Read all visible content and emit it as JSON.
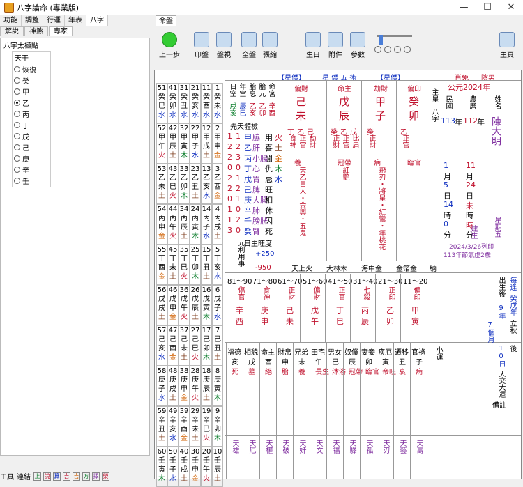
{
  "window": {
    "title": "八字論命 (專業版)",
    "minimize": "—",
    "maximize": "☐",
    "close": "✕"
  },
  "left": {
    "tabs": [
      "功能",
      "調整",
      "行運",
      "年表",
      "八字"
    ],
    "subtabs": [
      "解說",
      "神煞",
      "專家"
    ],
    "panel_title": "八字太極點",
    "group_title": "天干",
    "options": [
      "恢復",
      "癸",
      "甲",
      "乙",
      "丙",
      "丁",
      "戊",
      "己",
      "庚",
      "辛",
      "壬"
    ],
    "selected": "乙",
    "bottom_tools": [
      "工具",
      "連結"
    ],
    "bottom_small": [
      "上",
      "說",
      "算",
      "吉",
      "吉",
      "方",
      "擇",
      "榮"
    ]
  },
  "right": {
    "tab": "命盤",
    "toolbar": [
      "上一步",
      "印盤",
      "盤視",
      "全盤",
      "張縮",
      "生日",
      "附件",
      "參數",
      "主頁"
    ]
  },
  "chart": {
    "header": {
      "labels": [
        "【星僑】",
        "星 僑 五 術",
        "【星僑】"
      ],
      "zodiac": "肖兔",
      "gender": "陰男",
      "year": "公元2024年"
    },
    "tiangan_top": {
      "shishen": [
        "偏財",
        "命主",
        "劫財",
        "偏印"
      ],
      "stems": [
        "己",
        "戊",
        "甲",
        "癸"
      ],
      "branches": [
        "未",
        "辰",
        "子",
        "卯"
      ],
      "main_star": "主星",
      "bazi": "八字"
    },
    "name_block": {
      "label": "姓名",
      "name": "陳大明",
      "minguo": "民國",
      "nongli": "農曆",
      "year_m": "113",
      "year_n": "112",
      "unit": "年"
    },
    "date": {
      "m_month": "1",
      "m_day": "5",
      "m_hour": "14",
      "m_min": "0",
      "n_month": "11",
      "n_day": "24",
      "n_hour": "未",
      "n_time": "時",
      "unit_month": "月",
      "unit_day": "日",
      "unit_hour": "時",
      "unit_min": "分"
    },
    "birth": {
      "line1": "2024/3/26列印",
      "line2": "113年節氣虛2歲",
      "week": "星期五",
      "jian": "建生"
    },
    "hidden": [
      [
        "丁",
        "乙",
        "己"
      ],
      [
        "癸",
        "乙",
        "戊"
      ],
      [
        "癸"
      ],
      [
        "乙"
      ]
    ],
    "hidden_ss": [
      [
        "食神",
        "正官",
        "劫財"
      ],
      [
        "正財",
        "正官",
        "比肩"
      ],
      [
        "正財"
      ],
      [
        "正官"
      ]
    ],
    "life_stage": [
      "養",
      "冠帶",
      "病",
      "臨官"
    ],
    "shensha_cols": [
      "天乙貴人・金輿・五鬼",
      "紅艷",
      "飛刃・將星・紅鸞・年桃花",
      ""
    ],
    "nayin": [
      "天上火",
      "大林木",
      "海中金",
      "金箔金"
    ],
    "na": "納",
    "xianji": "先天體檢",
    "organs_a": [
      "脇",
      "肝",
      "小腸",
      "心",
      "胃",
      "脾",
      "大腸",
      "肺",
      "膀胱",
      "腎"
    ],
    "organs_b": [
      "甲",
      "乙",
      "丙",
      "丁",
      "戊",
      "己",
      "庚",
      "辛",
      "壬",
      "癸"
    ],
    "organs_c": [
      "1",
      "2",
      "3",
      "0",
      "1",
      "2",
      "1",
      "0",
      "2",
      "0"
    ],
    "organs_d": [
      "1",
      "2",
      "2",
      "0",
      "2",
      "2",
      "0",
      "1",
      "1",
      "3"
    ],
    "wuxing_state": [
      "旺",
      "相",
      "休",
      "囚",
      "死"
    ],
    "wuxing_elements": [
      "火",
      "土",
      "金",
      "木",
      "水"
    ],
    "rizhu": {
      "label": "日主旺度",
      "plus": "+250",
      "minus": "-950",
      "yuanli": "元利用事"
    },
    "col_headers": [
      "日空",
      "年空",
      "胎息",
      "胎元",
      "命宮"
    ],
    "col_values": [
      [
        "戌亥",
        "辰巳",
        "乙亥",
        "乙卯",
        "辛酉"
      ],
      [
        "",
        "",
        "",
        "",
        ""
      ]
    ],
    "luck_ages": [
      "81～90",
      "71～80",
      "61～70",
      "51～60",
      "41～50",
      "31～40",
      "21～30",
      "11～20"
    ],
    "luck_ss": [
      "傷官",
      "食神",
      "正財",
      "偏財",
      "正官",
      "七殺",
      "正印",
      "偏印"
    ],
    "luck_stems": [
      "辛",
      "庚",
      "己",
      "戊",
      "丁",
      "丙",
      "乙",
      "甲"
    ],
    "luck_branches": [
      "酉",
      "申",
      "未",
      "午",
      "巳",
      "辰",
      "卯",
      "寅"
    ],
    "luck_info": {
      "start": "出生後",
      "years": "9年",
      "months": "7個月",
      "days": "10日",
      "age1": "每逢",
      "age2": "癸戊年",
      "age3": "立秋",
      "age4": "後"
    },
    "palaces": [
      "福德",
      "相貌",
      "命主",
      "財帛",
      "兄弟",
      "田宅",
      "男女",
      "奴僕",
      "妻妾",
      "疾厄",
      "遷移",
      "官祿"
    ],
    "palace_branch": [
      "亥",
      "戌",
      "酉",
      "申",
      "未",
      "午",
      "巳",
      "辰",
      "卯",
      "寅",
      "丑",
      "子"
    ],
    "palace_stages": [
      "死",
      "墓",
      "絕",
      "胎",
      "養",
      "長生",
      "沐浴",
      "冠帶",
      "臨官",
      "帝旺",
      "衰",
      "病"
    ],
    "star_bottom": [
      "天雄",
      "天厄",
      "天權",
      "天破",
      "天奸",
      "天文",
      "天福",
      "天驛",
      "天孤",
      "天刃",
      "天藝",
      "天壽"
    ],
    "xiao_yun": "小運",
    "tianjiao": "天交大運",
    "beizhu": "備註",
    "left_grid": {
      "ages": [
        "51",
        "41",
        "31",
        "21",
        "11",
        "1",
        "52",
        "42",
        "32",
        "22",
        "12",
        "2",
        "53",
        "43",
        "33",
        "23",
        "13",
        "3",
        "54",
        "44",
        "34",
        "24",
        "14",
        "4",
        "55",
        "45",
        "35",
        "25",
        "15",
        "5",
        "56",
        "46",
        "36",
        "26",
        "16",
        "6",
        "57",
        "47",
        "37",
        "27",
        "17",
        "7",
        "58",
        "48",
        "38",
        "28",
        "18",
        "8",
        "59",
        "49",
        "39",
        "29",
        "19",
        "9",
        "60",
        "50",
        "40",
        "30",
        "20",
        "10"
      ],
      "stems_row": [
        "癸",
        "癸",
        "癸",
        "癸",
        "癸",
        "癸",
        "甲",
        "甲",
        "甲",
        "甲",
        "甲",
        "甲",
        "乙",
        "乙",
        "乙",
        "乙",
        "乙",
        "乙",
        "丙",
        "丙",
        "丙",
        "丙",
        "丙",
        "丙",
        "丁",
        "丁",
        "丁",
        "丁",
        "丁",
        "丁",
        "戊",
        "戊",
        "戊",
        "戊",
        "戊",
        "戊",
        "己",
        "己",
        "己",
        "己",
        "己",
        "己",
        "庚",
        "庚",
        "庚",
        "庚",
        "庚",
        "庚",
        "辛",
        "辛",
        "辛",
        "辛",
        "辛",
        "辛",
        "壬",
        "壬",
        "壬",
        "壬",
        "壬",
        "壬"
      ],
      "branch_row": [
        "巳",
        "卯",
        "丑",
        "亥",
        "酉",
        "未",
        "午",
        "辰",
        "寅",
        "子",
        "戌",
        "申",
        "未",
        "巳",
        "卯",
        "丑",
        "亥",
        "酉",
        "申",
        "午",
        "辰",
        "寅",
        "子",
        "戌",
        "酉",
        "未",
        "巳",
        "卯",
        "丑",
        "亥",
        "戌",
        "申",
        "午",
        "辰",
        "寅",
        "子",
        "亥",
        "酉",
        "未",
        "巳",
        "卯",
        "丑",
        "子",
        "戌",
        "申",
        "午",
        "辰",
        "寅",
        "丑",
        "亥",
        "酉",
        "未",
        "巳",
        "卯",
        "寅",
        "子",
        "戌",
        "申",
        "午",
        "辰"
      ],
      "elem_row": [
        "水",
        "水",
        "水",
        "水",
        "水",
        "水",
        "火",
        "土",
        "木",
        "水",
        "土",
        "金",
        "土",
        "火",
        "木",
        "土",
        "水",
        "金",
        "金",
        "火",
        "土",
        "木",
        "水",
        "土",
        "金",
        "土",
        "火",
        "木",
        "土",
        "水",
        "土",
        "金",
        "火",
        "土",
        "木",
        "水",
        "水",
        "金",
        "土",
        "火",
        "木",
        "土",
        "水",
        "土",
        "金",
        "火",
        "土",
        "木",
        "土",
        "水",
        "金",
        "土",
        "火",
        "木",
        "木",
        "水",
        "土",
        "金",
        "火",
        "土"
      ]
    }
  }
}
